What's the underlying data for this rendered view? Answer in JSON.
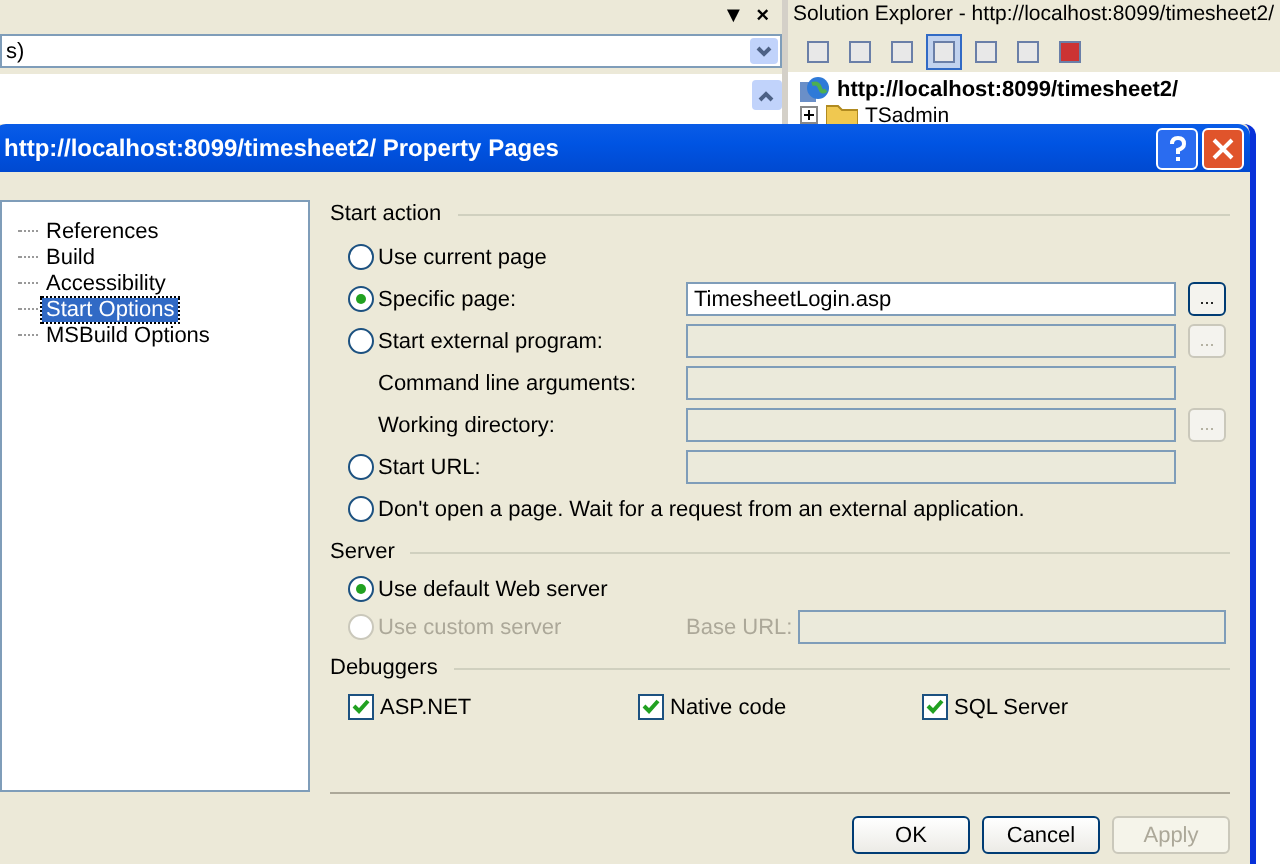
{
  "ide": {
    "left_pane": {
      "header_glyphs": [
        "▼",
        "×"
      ],
      "combo_value": "s)"
    },
    "solution_explorer": {
      "title": "Solution Explorer - http://localhost:8099/timesheet2/",
      "tree": [
        {
          "label": "http://localhost:8099/timesheet2/",
          "kind": "site",
          "children": [
            {
              "label": "TSadmin",
              "kind": "folder"
            }
          ]
        }
      ]
    }
  },
  "dialog": {
    "title": "http://localhost:8099/timesheet2/ Property Pages",
    "nav": [
      {
        "label": "References",
        "selected": false
      },
      {
        "label": "Build",
        "selected": false
      },
      {
        "label": "Accessibility",
        "selected": false
      },
      {
        "label": "Start Options",
        "selected": true
      },
      {
        "label": "MSBuild Options",
        "selected": false
      }
    ],
    "start_action": {
      "label": "Start action",
      "rows": [
        {
          "kind": "radio",
          "label": "Use current page",
          "selected": false
        },
        {
          "kind": "radio",
          "label": "Specific page:",
          "selected": true,
          "field": {
            "value": "TimesheetLogin.asp",
            "disabled": false
          },
          "browse": {
            "label": "...",
            "disabled": false
          }
        },
        {
          "kind": "radio",
          "label": "Start external program:",
          "selected": false,
          "field": {
            "disabled": true
          },
          "browse": {
            "label": "...",
            "disabled": true
          }
        },
        {
          "kind": "label",
          "label": "Command line arguments:",
          "field": {
            "disabled": true
          }
        },
        {
          "kind": "label",
          "label": "Working directory:",
          "field": {
            "disabled": true
          },
          "browse": {
            "label": "...",
            "disabled": true
          }
        },
        {
          "kind": "radio",
          "label": "Start URL:",
          "selected": false,
          "field": {
            "disabled": true
          }
        },
        {
          "kind": "radio",
          "label": "Don't open a page. Wait for a request from an external application.",
          "selected": false
        }
      ]
    },
    "server": {
      "label": "Server",
      "options": [
        {
          "label": "Use default Web server",
          "selected": true,
          "disabled": false
        },
        {
          "label": "Use custom server",
          "selected": false,
          "disabled": true
        }
      ],
      "base_url": {
        "label": "Base URL:",
        "disabled": true
      }
    },
    "debuggers": {
      "label": "Debuggers",
      "items": [
        {
          "label": "ASP.NET",
          "checked": true
        },
        {
          "label": "Native code",
          "checked": true
        },
        {
          "label": "SQL Server",
          "checked": true
        }
      ]
    },
    "buttons": [
      {
        "label": "OK",
        "disabled": false
      },
      {
        "label": "Cancel",
        "disabled": false
      },
      {
        "label": "Apply",
        "disabled": true
      }
    ]
  }
}
